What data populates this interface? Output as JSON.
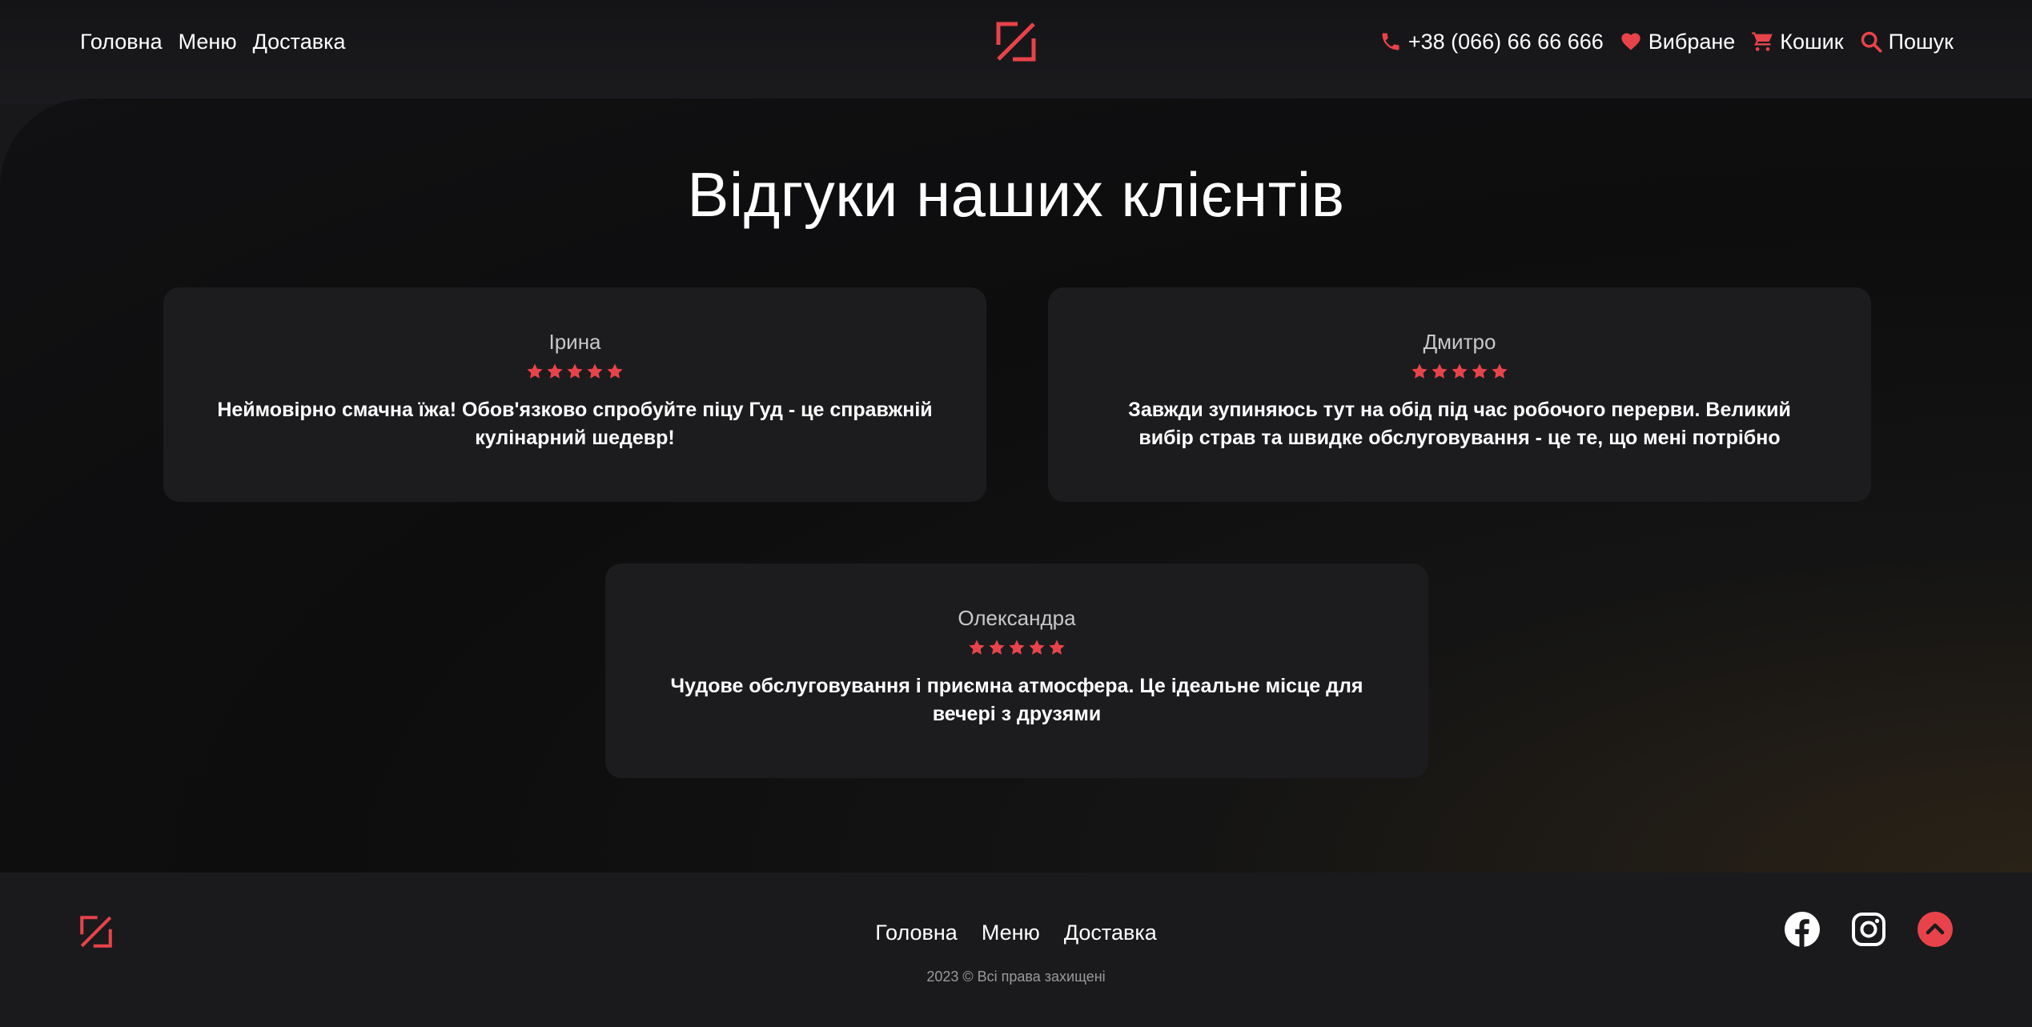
{
  "header": {
    "nav": [
      {
        "label": "Головна"
      },
      {
        "label": "Меню"
      },
      {
        "label": "Доставка"
      }
    ],
    "phone": "+38 (066) 66 66 666",
    "favorites": "Вибране",
    "cart": "Кошик",
    "search": "Пошук"
  },
  "main": {
    "title": "Відгуки наших клієнтів",
    "reviews": [
      {
        "name": "Ірина",
        "rating": 5,
        "text": "Неймовірно смачна їжа! Обов'язково спробуйте піцу Гуд - це справжній кулінарний шедевр!"
      },
      {
        "name": "Дмитро",
        "rating": 5,
        "text": "Завжди зупиняюсь тут на обід під час робочого перерви. Великий вибір страв та швидке обслуговування - це те, що мені потрібно"
      },
      {
        "name": "Олександра",
        "rating": 5,
        "text": "Чудове обслуговування і приємна атмосфера. Це ідеальне місце для вечері з друзями"
      }
    ]
  },
  "footer": {
    "nav": [
      {
        "label": "Головна"
      },
      {
        "label": "Меню"
      },
      {
        "label": "Доставка"
      }
    ],
    "copyright": "2023 © Всі права захищені",
    "social_icons": [
      "facebook-icon",
      "instagram-icon",
      "scroll-top-icon"
    ]
  },
  "colors": {
    "accent": "#e8434a",
    "background": "#18181b",
    "card": "#1c1c1f",
    "text": "#ffffff"
  }
}
